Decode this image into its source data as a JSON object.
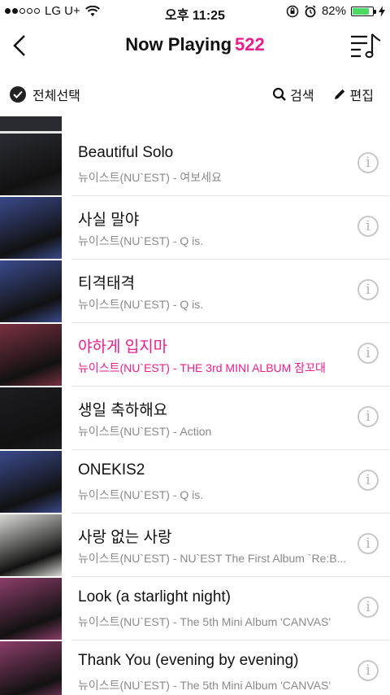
{
  "status": {
    "carrier": "LG U+",
    "time": "오후 11:25",
    "battery": "82%",
    "battery_level": 0.82
  },
  "header": {
    "title": "Now Playing",
    "count": "522"
  },
  "toolbar": {
    "select_all": "전체선택",
    "search": "검색",
    "edit": "편집"
  },
  "colors": {
    "accent": "#e91e8c"
  },
  "songs": [
    {
      "title": "Beautiful Solo",
      "artist": "뉴이스트(NU`EST) - 여보세요",
      "art": "#2b2c33"
    },
    {
      "title": "사실 말야",
      "artist": "뉴이스트(NU`EST) - Q is.",
      "art": "#3a4a8c"
    },
    {
      "title": "티격태격",
      "artist": "뉴이스트(NU`EST) - Q is.",
      "art": "#3a4a8c"
    },
    {
      "title": "야하게 입지마",
      "artist": "뉴이스트(NU`EST) - THE 3rd MINI ALBUM 잠꼬대",
      "art": "#7a3040",
      "active": true
    },
    {
      "title": "생일 축하해요",
      "artist": "뉴이스트(NU`EST) - Action",
      "art": "#1d1d22"
    },
    {
      "title": "ONEKIS2",
      "artist": "뉴이스트(NU`EST) - Q is.",
      "art": "#3a4a8c"
    },
    {
      "title": "사랑 없는 사랑",
      "artist": "뉴이스트(NU`EST) - NU`EST The First Album `Re:B...",
      "art": "#d9d9d4"
    },
    {
      "title": "Look (a starlight night)",
      "artist": "뉴이스트(NU`EST) - The 5th Mini Album 'CANVAS'",
      "art": "#8c3d6a"
    },
    {
      "title": "Thank You (evening by evening)",
      "artist": "뉴이스트(NU`EST) - The 5th Mini Album 'CANVAS'",
      "art": "#8c3d6a"
    }
  ]
}
